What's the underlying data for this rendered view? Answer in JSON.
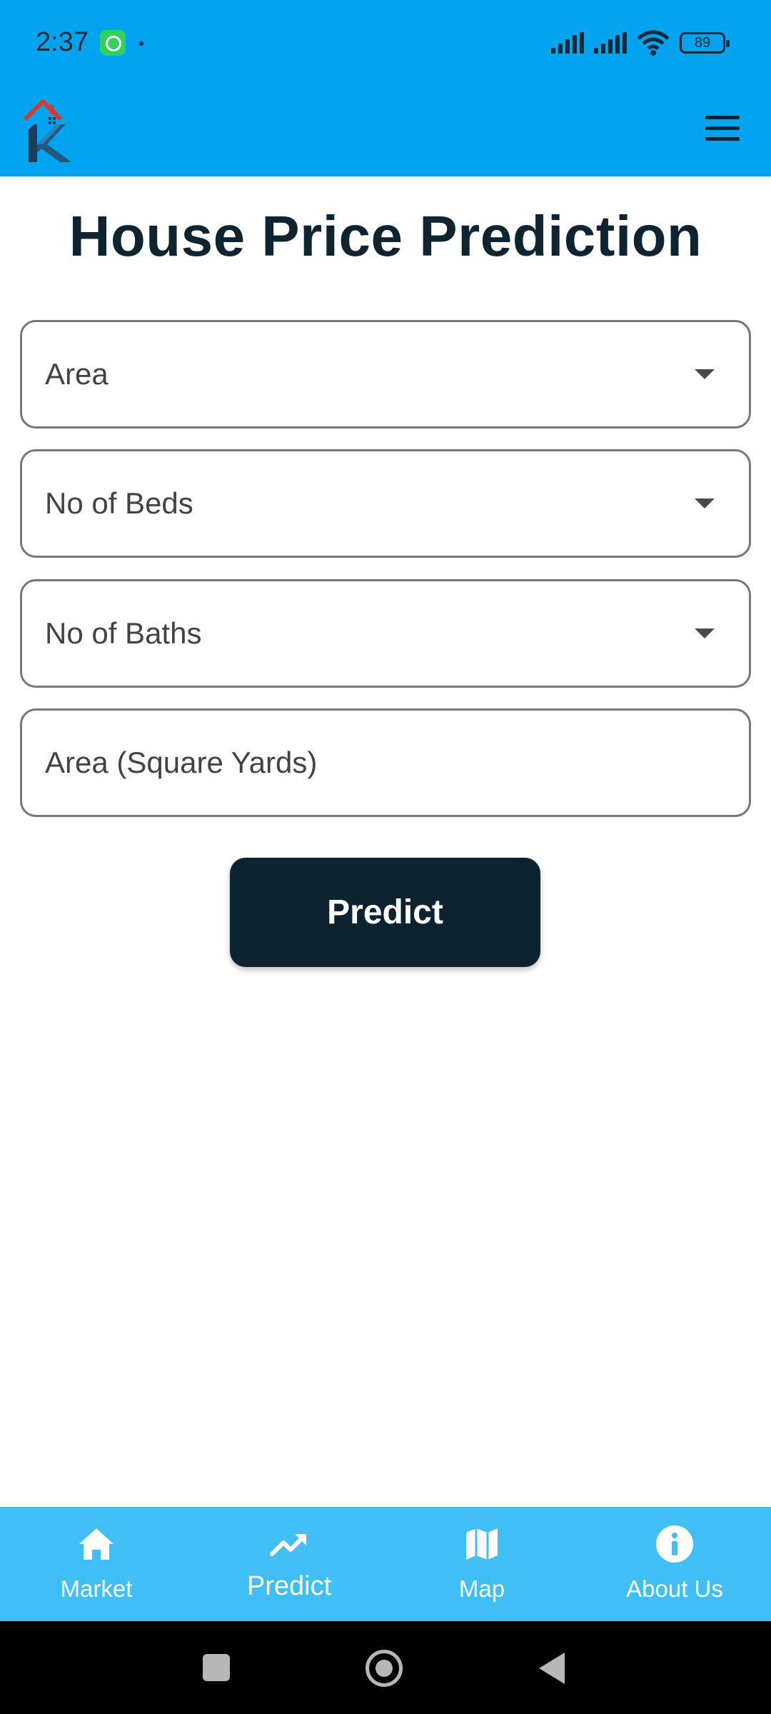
{
  "status_bar": {
    "time": "2:37",
    "battery": "89",
    "notification_icons": [
      "whatsapp-icon"
    ],
    "right_icons": [
      "signal-icon",
      "signal-icon",
      "wifi-icon",
      "battery-icon"
    ]
  },
  "app_bar": {
    "logo_icon": "house-k-logo",
    "menu_icon": "hamburger-menu-icon",
    "background_color": "#03a4ef"
  },
  "page": {
    "title": "House Price Prediction"
  },
  "form": {
    "area_select_label": "Area",
    "beds_select_label": "No of Beds",
    "baths_select_label": "No of Baths",
    "square_yards_placeholder": "Area (Square Yards)",
    "predict_label": "Predict"
  },
  "bottom_nav": {
    "background_color": "#3fbff5",
    "items": [
      {
        "label": "Market",
        "icon": "home-icon"
      },
      {
        "label": "Predict",
        "icon": "trending-up-icon"
      },
      {
        "label": "Map",
        "icon": "map-icon"
      },
      {
        "label": "About Us",
        "icon": "info-icon"
      }
    ],
    "active_index": 1
  },
  "system_nav": {
    "icons": [
      "recents-icon",
      "home-circle-icon",
      "back-icon"
    ]
  }
}
